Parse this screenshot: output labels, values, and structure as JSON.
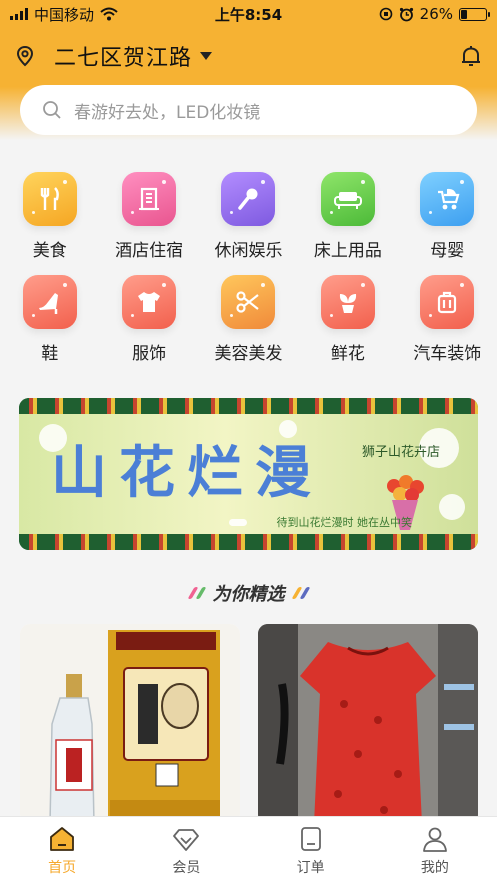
{
  "status_bar": {
    "carrier": "中国移动",
    "time": "上午8:54",
    "battery": "26%",
    "battery_level": 0.26
  },
  "header": {
    "location_name": "二七区贺江路",
    "location_icon": "map-pin-icon",
    "notification_icon": "bell-icon"
  },
  "search": {
    "placeholder": "春游好去处，LED化妆镜",
    "icon": "search-icon"
  },
  "categories": [
    {
      "label": "美食",
      "icon": "utensils-icon",
      "color": "#f5b53a"
    },
    {
      "label": "酒店住宿",
      "icon": "hotel-icon",
      "color": "#f06fa1"
    },
    {
      "label": "休闲娱乐",
      "icon": "microphone-icon",
      "color": "#9b72e8"
    },
    {
      "label": "床上用品",
      "icon": "sofa-icon",
      "color": "#6ccf4f"
    },
    {
      "label": "母婴",
      "icon": "stroller-icon",
      "color": "#4fb3f0"
    },
    {
      "label": "鞋",
      "icon": "high-heel-icon",
      "color": "#f7796b"
    },
    {
      "label": "服饰",
      "icon": "tshirt-icon",
      "color": "#f7796b"
    },
    {
      "label": "美容美发",
      "icon": "scissors-icon",
      "color": "#f5a33a"
    },
    {
      "label": "鲜花",
      "icon": "potted-plant-icon",
      "color": "#f7796b"
    },
    {
      "label": "汽车装饰",
      "icon": "luggage-icon",
      "color": "#f7796b"
    }
  ],
  "banner": {
    "headline": "山花烂漫",
    "shop_name": "狮子山花卉店",
    "slogan": "待到山花烂漫时 她在丛中笑"
  },
  "section": {
    "title": "为你精选"
  },
  "products": [
    {
      "image": "baiyun-bian-liquor-photo"
    },
    {
      "image": "red-dress-photo"
    }
  ],
  "tabs": [
    {
      "label": "首页",
      "icon": "home-icon",
      "active": true
    },
    {
      "label": "会员",
      "icon": "diamond-icon",
      "active": false
    },
    {
      "label": "订单",
      "icon": "order-document-icon",
      "active": false
    },
    {
      "label": "我的",
      "icon": "user-icon",
      "active": false
    }
  ],
  "colors": {
    "brand": "#f6b233",
    "active_tab": "#f6a92c"
  }
}
